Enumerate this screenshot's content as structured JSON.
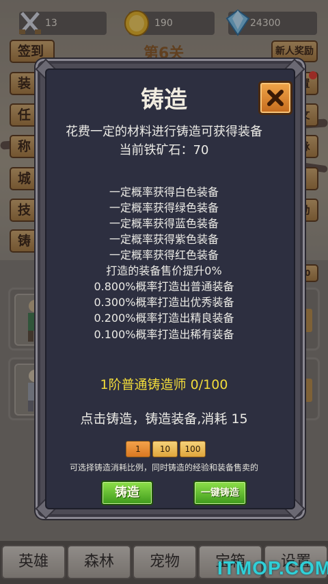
{
  "resources": {
    "weapon_count": "13",
    "gold": "190",
    "diamond": "24300"
  },
  "side_menu": [
    {
      "label": "签到"
    },
    {
      "label": "装"
    },
    {
      "label": "任"
    },
    {
      "label": "称"
    },
    {
      "label": "城"
    },
    {
      "label": "技"
    },
    {
      "label": "铸"
    }
  ],
  "level_title": "第6关",
  "new_player_reward": "新人奖励",
  "right_menu": [
    {
      "label": "置"
    },
    {
      "label": "文"
    },
    {
      "label": "脉"
    },
    {
      "label": ""
    },
    {
      "label": "动"
    },
    {
      "label": "00"
    }
  ],
  "dialog": {
    "title": "铸造",
    "description": "花费一定的材料进行铸造可获得装备",
    "iron_ore_label": "当前铁矿石：70",
    "probabilities": [
      "一定概率获得白色装备",
      "一定概率获得绿色装备",
      "一定概率获得蓝色装备",
      "一定概率获得紫色装备",
      "一定概率获得红色装备",
      "打造的装备售价提升0%",
      "0.800%概率打造出普通装备",
      "0.300%概率打造出优秀装备",
      "0.200%概率打造出精良装备",
      "0.100%概率打造出稀有装备"
    ],
    "smith_rank": "1阶普通铸造师 0/100",
    "cost_text": "点击铸造，铸造装备,消耗 15",
    "ratio_options": [
      "1",
      "10",
      "100"
    ],
    "selected_ratio": "1",
    "hint": "可选择铸造消耗比例，同时铸造的经验和装备售卖的",
    "forge_button": "铸造",
    "forge_all_button": "一键铸造"
  },
  "bottom_tabs": [
    {
      "label": "英雄"
    },
    {
      "label": "森林"
    },
    {
      "label": "宠物"
    },
    {
      "label": "宝箱"
    },
    {
      "label": "设置"
    }
  ],
  "watermark": "ITMOP.COM",
  "colors": {
    "dialog_bg": "#2d2f40",
    "rank_yellow": "#f2dc3a",
    "button_green": "#3e9a1c",
    "close_orange": "#e08a34"
  }
}
